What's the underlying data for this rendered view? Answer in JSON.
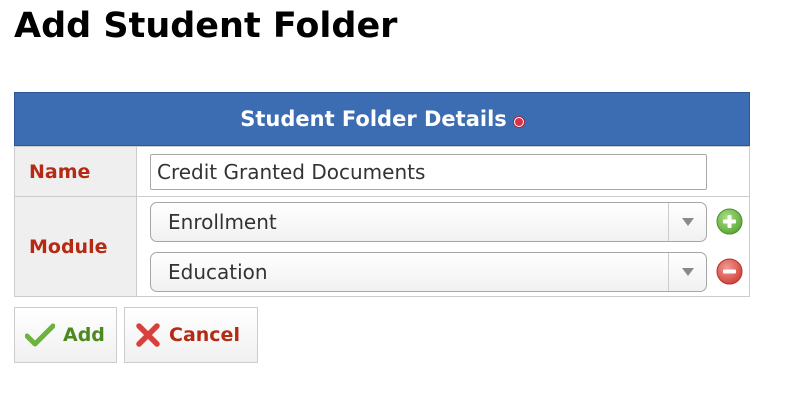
{
  "page": {
    "title": "Add Student Folder"
  },
  "panel": {
    "header": "Student Folder Details",
    "required_icon": "required-dot-icon"
  },
  "form": {
    "name": {
      "label": "Name",
      "value": "Credit Granted Documents"
    },
    "module": {
      "label": "Module",
      "selects": [
        {
          "value": "Enrollment",
          "action_icon": "add-circle-icon"
        },
        {
          "value": "Education",
          "action_icon": "remove-circle-icon"
        }
      ]
    }
  },
  "buttons": {
    "add_label": "Add",
    "add_icon": "checkmark-icon",
    "cancel_label": "Cancel",
    "cancel_icon": "x-cross-icon"
  },
  "colors": {
    "header_bg": "#3c6db3",
    "label_text": "#b52a12",
    "add_text": "#4c8a21",
    "add_circle": "#6fbb4a",
    "remove_circle": "#d9534f"
  }
}
